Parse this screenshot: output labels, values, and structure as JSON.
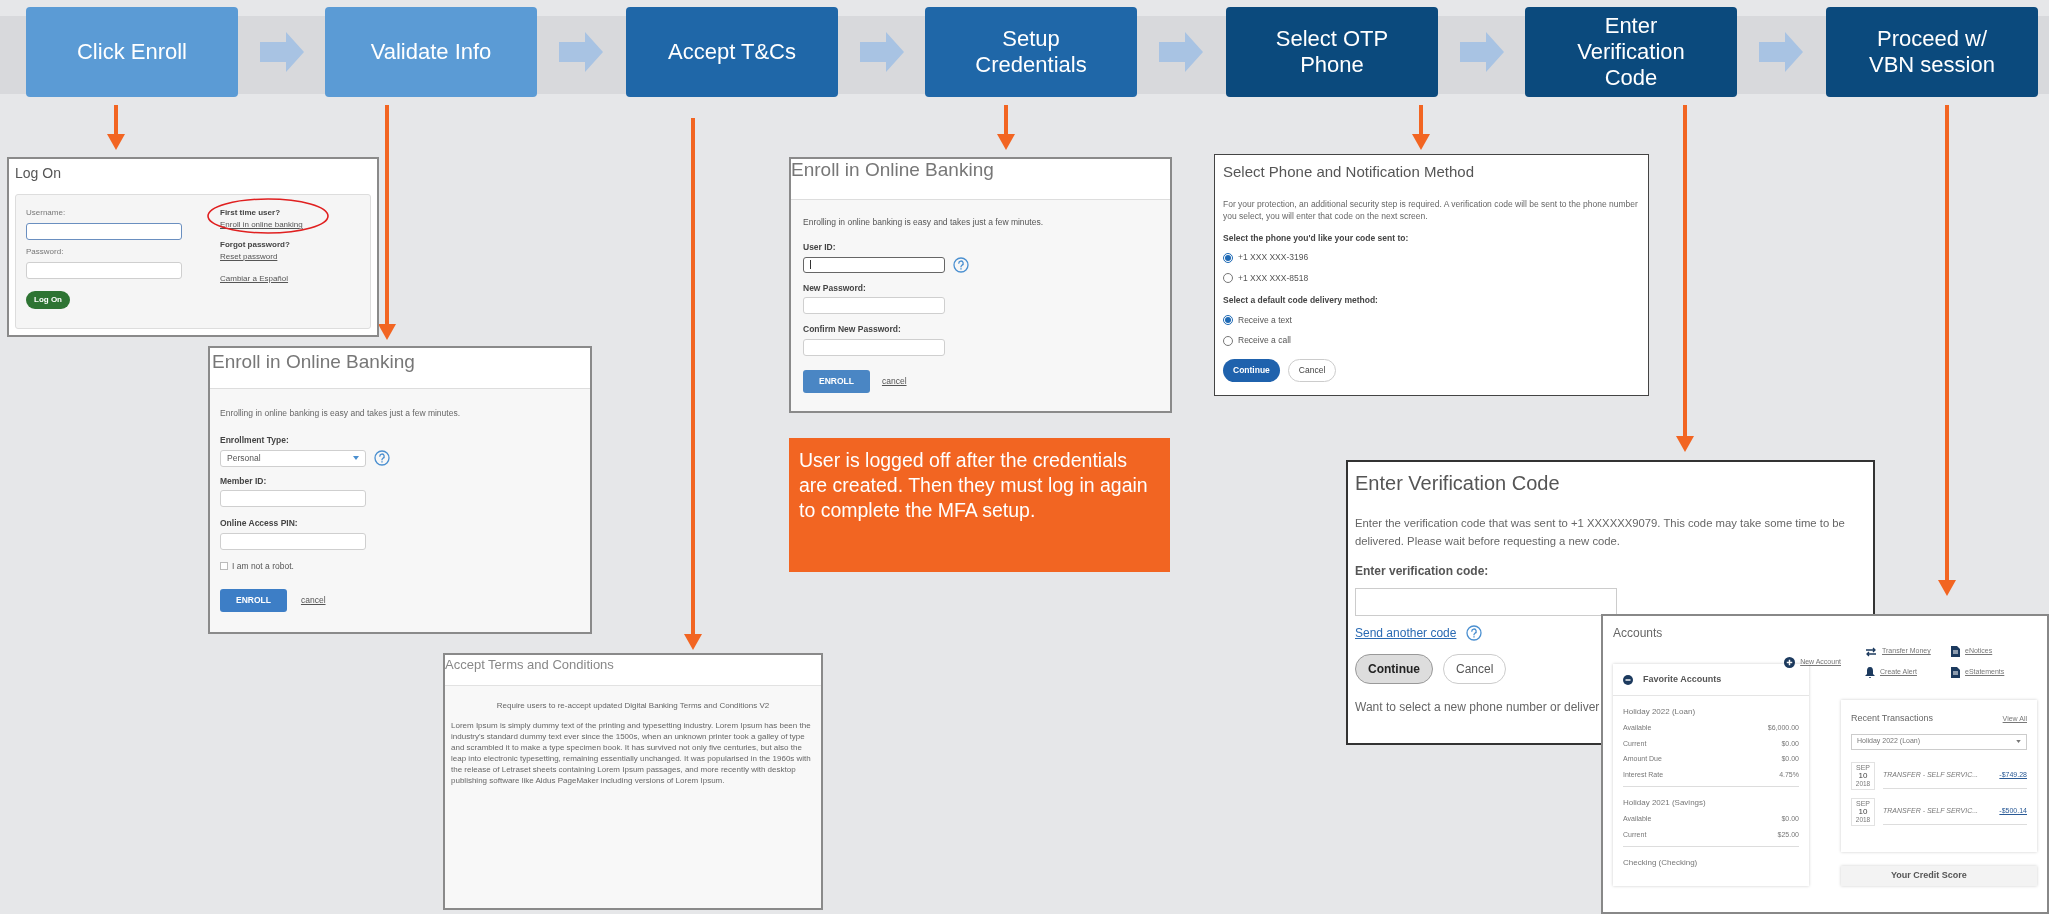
{
  "steps": [
    {
      "label": "Click Enroll",
      "color": "#5b9bd5"
    },
    {
      "label": "Validate Info",
      "color": "#5b9bd5"
    },
    {
      "label": "Accept T&Cs",
      "color": "#1f67a8"
    },
    {
      "label": "Setup Credentials",
      "color": "#1f67a8"
    },
    {
      "label": "Select OTP Phone",
      "color": "#0b4a7d"
    },
    {
      "label": "Enter Verification Code",
      "color": "#0b4a7d"
    },
    {
      "label": "Proceed w/ VBN session",
      "color": "#0b4a7d"
    }
  ],
  "log_on": {
    "title": "Log On",
    "username_label": "Username:",
    "password_label": "Password:",
    "button": "Log On",
    "first_time": "First time user?",
    "enroll_link": "Enroll in online banking",
    "forgot": "Forgot password?",
    "reset_link": "Reset password",
    "spanish_link": "Cambiar a Español"
  },
  "enroll_validate": {
    "title": "Enroll in Online Banking",
    "intro": "Enrolling in online banking is easy and takes just a few minutes.",
    "type_label": "Enrollment Type:",
    "type_value": "Personal",
    "member_label": "Member ID:",
    "pin_label": "Online Access PIN:",
    "robot": {
      "label": "I am not a robot.",
      "checked": false
    },
    "button": "ENROLL",
    "cancel": "cancel"
  },
  "terms": {
    "title": "Accept Terms and Conditions",
    "heading": "Require users to re-accept updated Digital Banking Terms and Conditions V2",
    "body": "Lorem Ipsum is simply dummy text of the printing and typesetting industry. Lorem Ipsum has been the industry's standard dummy text ever since the 1500s, when an unknown printer took a galley of type and scrambled it to make a type specimen book. It has survived not only five centuries, but also the leap into electronic typesetting, remaining essentially unchanged. It was popularised in the 1960s with the release of Letraset sheets containing Lorem Ipsum passages, and more recently with desktop publishing software like Aldus PageMaker including versions of Lorem Ipsum."
  },
  "enroll_credentials": {
    "title": "Enroll in Online Banking",
    "intro": "Enrolling in online banking is easy and takes just a few minutes.",
    "user_label": "User ID:",
    "new_password_label": "New Password:",
    "confirm_label": "Confirm New Password:",
    "button": "ENROLL",
    "cancel": "cancel"
  },
  "note": "User is logged off after the credentials are created. Then they must log in again to complete the MFA setup.",
  "select_phone": {
    "title": "Select Phone and Notification Method",
    "intro": "For your protection, an additional security step is required. A verification code will be sent to the phone number you select, you will enter that code on the next screen.",
    "phone_label": "Select the phone you'd like your code sent to:",
    "phones": [
      {
        "label": "+1 XXX XXX-3196",
        "selected": true
      },
      {
        "label": "+1 XXX XXX-8518",
        "selected": false
      }
    ],
    "method_label": "Select a default code delivery method:",
    "methods": [
      {
        "label": "Receive a text",
        "selected": true
      },
      {
        "label": "Receive a call",
        "selected": false
      }
    ],
    "continue": "Continue",
    "cancel": "Cancel"
  },
  "verify": {
    "title": "Enter Verification Code",
    "intro": "Enter the verification code that was sent to +1 XXXXXX9079. This code may take some time to be delivered. Please wait before requesting a new code.",
    "code_label": "Enter verification code:",
    "resend": "Send another code",
    "continue": "Continue",
    "cancel": "Cancel",
    "footer": "Want to select a new phone number or deliver"
  },
  "accounts": {
    "title": "Accounts",
    "actions": [
      {
        "label": "New Account",
        "kind": "plus"
      },
      {
        "label": "Transfer Money",
        "kind": "transfer"
      },
      {
        "label": "eNotices",
        "kind": "document"
      },
      {
        "label": "Create Alert",
        "kind": "bell"
      },
      {
        "label": "eStatements",
        "kind": "document"
      }
    ],
    "favorites_title": "Favorite Accounts",
    "groups": [
      {
        "name": "Holiday 2022 (Loan)",
        "rows": [
          [
            "Available",
            "$6,000.00"
          ],
          [
            "Current",
            "$0.00"
          ],
          [
            "Amount Due",
            "$0.00"
          ],
          [
            "Interest Rate",
            "4.75%"
          ]
        ]
      },
      {
        "name": "Holiday 2021 (Savings)",
        "rows": [
          [
            "Available",
            "$0.00"
          ],
          [
            "Current",
            "$25.00"
          ]
        ]
      },
      {
        "name": "Checking (Checking)"
      }
    ],
    "recent_title": "Recent Transactions",
    "view_all": "View All",
    "account_select": "Holiday 2022 (Loan)",
    "transactions": [
      {
        "month": "SEP",
        "day": "10",
        "year": "2018",
        "description": "TRANSFER - SELF SERVIC...",
        "amount": "-$749.28"
      },
      {
        "month": "SEP",
        "day": "10",
        "year": "2018",
        "description": "TRANSFER - SELF SERVIC...",
        "amount": "-$500.14"
      }
    ],
    "credit_title": "Your Credit Score"
  }
}
